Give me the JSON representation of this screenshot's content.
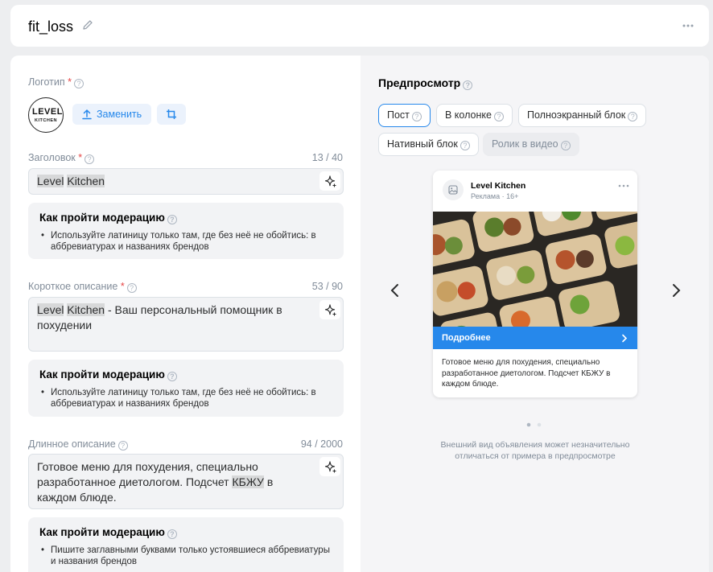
{
  "header": {
    "title": "fit_loss"
  },
  "logo": {
    "label": "Логотип",
    "required": "*",
    "brand_line1": "LEVEL",
    "brand_line2": "KITCHEN",
    "replace_label": "Заменить"
  },
  "headline": {
    "label": "Заголовок",
    "required": "*",
    "counter": "13 / 40",
    "value_hl1": "Level",
    "value_hl2": "Kitchen"
  },
  "moderation1": {
    "title": "Как пройти модерацию",
    "text": "Используйте латиницу только там, где без неё не обойтись: в аббревиатурах и названиях брендов"
  },
  "short_desc": {
    "label": "Короткое описание",
    "required": "*",
    "counter": "53 / 90",
    "value_hl1": "Level",
    "value_hl2": "Kitchen",
    "value_rest": " - Ваш персональный помощник в похудении"
  },
  "moderation2": {
    "title": "Как пройти модерацию",
    "text": "Используйте латиницу только там, где без неё не обойтись: в аббревиатурах и названиях брендов"
  },
  "long_desc": {
    "label": "Длинное описание",
    "counter": "94 / 2000",
    "value_before": "Готовое меню для похудения, специально разработанное диетологом. Подсчет ",
    "value_hl": "КБЖУ",
    "value_after": " в каждом блюде."
  },
  "moderation3": {
    "title": "Как пройти модерацию",
    "text": "Пишите заглавными буквами только устоявшиеся аббревиатуры и названия брендов"
  },
  "preview": {
    "title": "Предпросмотр",
    "tabs": [
      "Пост",
      "В колонке",
      "Полноэкранный блок",
      "Нативный блок",
      "Ролик в видео"
    ],
    "ad": {
      "name": "Level Kitchen",
      "sub": "Реклама · 16+",
      "cta": "Подробнее",
      "desc": "Готовое меню для похудения, специально разработанное диетологом. Подсчет КБЖУ в каждом блюде."
    },
    "note": "Внешний вид объявления может незначительно отличаться от примера в предпросмотре"
  },
  "colors": {
    "accent": "#2688eb",
    "panel": "#f2f3f5"
  }
}
